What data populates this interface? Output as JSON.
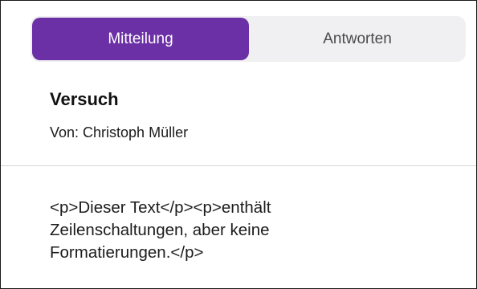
{
  "tabs": [
    {
      "label": "Mitteilung",
      "active": true
    },
    {
      "label": "Antworten",
      "active": false
    }
  ],
  "message": {
    "title": "Versuch",
    "sender": "Von: Christoph Müller",
    "body": "<p>Dieser Text</p><p>enthält Zeilenschaltungen, aber keine Formatierungen.</p>"
  },
  "colors": {
    "accent": "#6b2fa6",
    "segment_background": "#f0f0f2",
    "divider": "#d6d6da"
  }
}
